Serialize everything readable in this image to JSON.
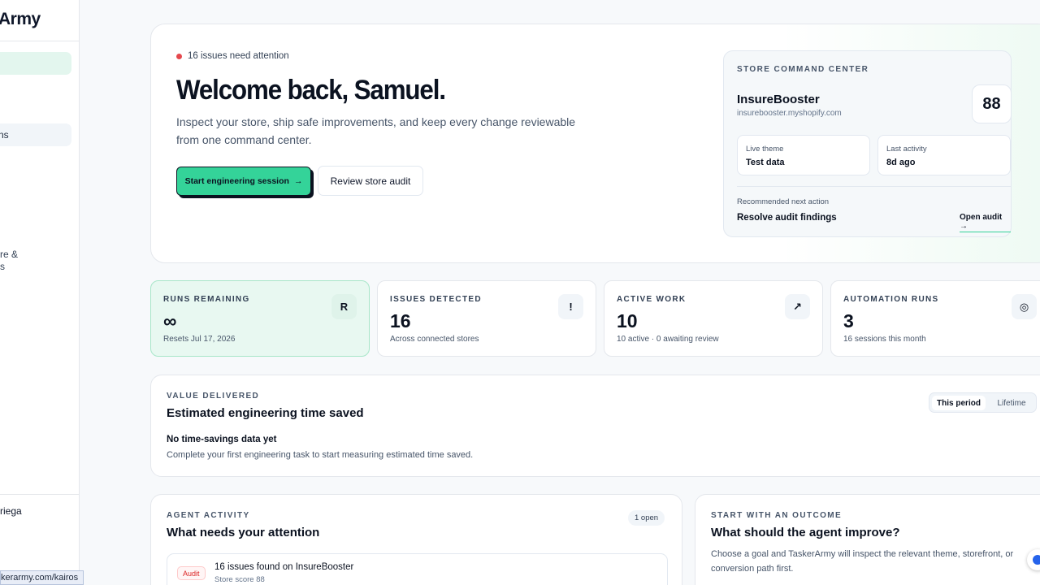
{
  "sidebar": {
    "logo": "Army",
    "item_partial": "ns",
    "item3_partial": "re &\ns",
    "user_partial": "riega"
  },
  "url_tooltip": "kerarmy.com/kairos",
  "hero": {
    "status": "16 issues need attention",
    "title": "Welcome back, Samuel.",
    "subtitle": "Inspect your store, ship safe improvements, and keep every change reviewable from one command center.",
    "primary_button": "Start engineering session",
    "primary_arrow": "→",
    "secondary_button": "Review store audit"
  },
  "command_center": {
    "label": "STORE COMMAND CENTER",
    "store_name": "InsureBooster",
    "domain": "insurebooster.myshopify.com",
    "score": "88",
    "live_theme_label": "Live theme",
    "live_theme_value": "Test data",
    "last_activity_label": "Last activity",
    "last_activity_value": "8d ago",
    "recommended_label": "Recommended next action",
    "recommended_value": "Resolve audit findings",
    "open_link": "Open audit →"
  },
  "stats": [
    {
      "label": "RUNS REMAINING",
      "value": "∞",
      "sub": "Resets Jul 17, 2026",
      "icon": "R",
      "icon_name": "runs-icon"
    },
    {
      "label": "ISSUES DETECTED",
      "value": "16",
      "sub": "Across connected stores",
      "icon": "!",
      "icon_name": "alert-icon"
    },
    {
      "label": "ACTIVE WORK",
      "value": "10",
      "sub": "10 active · 0 awaiting review",
      "icon": "↗",
      "icon_name": "arrow-up-right-icon"
    },
    {
      "label": "AUTOMATION RUNS",
      "value": "3",
      "sub": "16 sessions this month",
      "icon": "◎",
      "icon_name": "target-icon"
    }
  ],
  "value_delivered": {
    "label": "VALUE DELIVERED",
    "title": "Estimated engineering time saved",
    "toggle_active": "This period",
    "toggle_inactive": "Lifetime",
    "empty_title": "No time-savings data yet",
    "empty_sub": "Complete your first engineering task to start measuring estimated time saved."
  },
  "agent_activity": {
    "label": "AGENT ACTIVITY",
    "title": "What needs your attention",
    "badge": "1 open",
    "row_tag": "Audit",
    "row_title": "16 issues found on InsureBooster",
    "row_sub": "Store score 88"
  },
  "outcome": {
    "label": "START WITH AN OUTCOME",
    "title": "What should the agent improve?",
    "sub": "Choose a goal and TaskerArmy will inspect the relevant theme, storefront, or conversion path first."
  },
  "colors": {
    "accent": "#34d399",
    "alert": "#e5484d",
    "text": "#0b1220"
  }
}
